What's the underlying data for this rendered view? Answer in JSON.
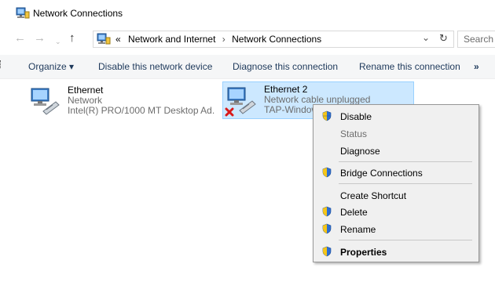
{
  "window": {
    "title": "Network Connections"
  },
  "address": {
    "overflow": "«",
    "crumbs": [
      "Network and Internet",
      "Network Connections"
    ],
    "separator": "›",
    "dropdown_glyph": "⌄",
    "refresh_glyph": "↻"
  },
  "search": {
    "placeholder": "Search N"
  },
  "nav": {
    "back": "←",
    "forward": "→",
    "recent": "⌄",
    "up": "↑"
  },
  "toolbar": {
    "organize": "Organize ▾",
    "disable": "Disable this network device",
    "diagnose": "Diagnose this connection",
    "rename": "Rename this connection",
    "more": "»"
  },
  "connections": [
    {
      "name": "Ethernet",
      "status": "Network",
      "device": "Intel(R) PRO/1000 MT Desktop Ad...",
      "unplugged": false,
      "selected": false
    },
    {
      "name": "Ethernet 2",
      "status": "Network cable unplugged",
      "device": "TAP-Windows Adapter V9",
      "unplugged": true,
      "selected": true
    }
  ],
  "context_menu": {
    "items": [
      {
        "label": "Disable",
        "shield": true,
        "bold": false,
        "disabled": false
      },
      {
        "label": "Status",
        "shield": false,
        "bold": false,
        "disabled": true
      },
      {
        "label": "Diagnose",
        "shield": false,
        "bold": false,
        "disabled": false
      },
      {
        "label": "Bridge Connections",
        "shield": true,
        "bold": false,
        "disabled": false
      },
      {
        "label": "Create Shortcut",
        "shield": false,
        "bold": false,
        "disabled": false
      },
      {
        "label": "Delete",
        "shield": true,
        "bold": false,
        "disabled": false
      },
      {
        "label": "Rename",
        "shield": true,
        "bold": false,
        "disabled": false
      },
      {
        "label": "Properties",
        "shield": true,
        "bold": true,
        "disabled": false
      }
    ]
  },
  "colors": {
    "selection_bg": "#cce8ff",
    "selection_border": "#99d1ff",
    "command_bar_bg": "#f5f6f7",
    "command_text": "#1e395b",
    "menu_bg": "#f0f0f0"
  }
}
